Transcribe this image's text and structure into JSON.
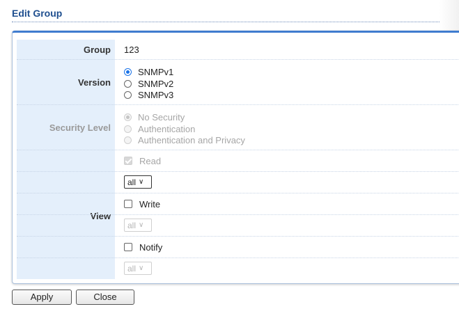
{
  "page": {
    "title": "Edit Group"
  },
  "form": {
    "group": {
      "label": "Group",
      "value": "123"
    },
    "version": {
      "label": "Version",
      "options": [
        "SNMPv1",
        "SNMPv2",
        "SNMPv3"
      ],
      "selected": "SNMPv1"
    },
    "security_level": {
      "label": "Security Level",
      "options": [
        "No Security",
        "Authentication",
        "Authentication and Privacy"
      ],
      "selected": "No Security",
      "disabled": true
    },
    "view": {
      "label": "View",
      "read": {
        "label": "Read",
        "checked": true,
        "disabled": true,
        "select_value": "all"
      },
      "write": {
        "label": "Write",
        "checked": false,
        "select_value": "all",
        "select_disabled": true
      },
      "notify": {
        "label": "Notify",
        "checked": false,
        "select_value": "all",
        "select_disabled": true
      }
    }
  },
  "buttons": {
    "apply": "Apply",
    "close": "Close"
  },
  "colors": {
    "title": "#1f4f8f",
    "accent": "#3f7ccf",
    "label_bg": "#e4effb",
    "radio_checked": "#1a73e8"
  }
}
